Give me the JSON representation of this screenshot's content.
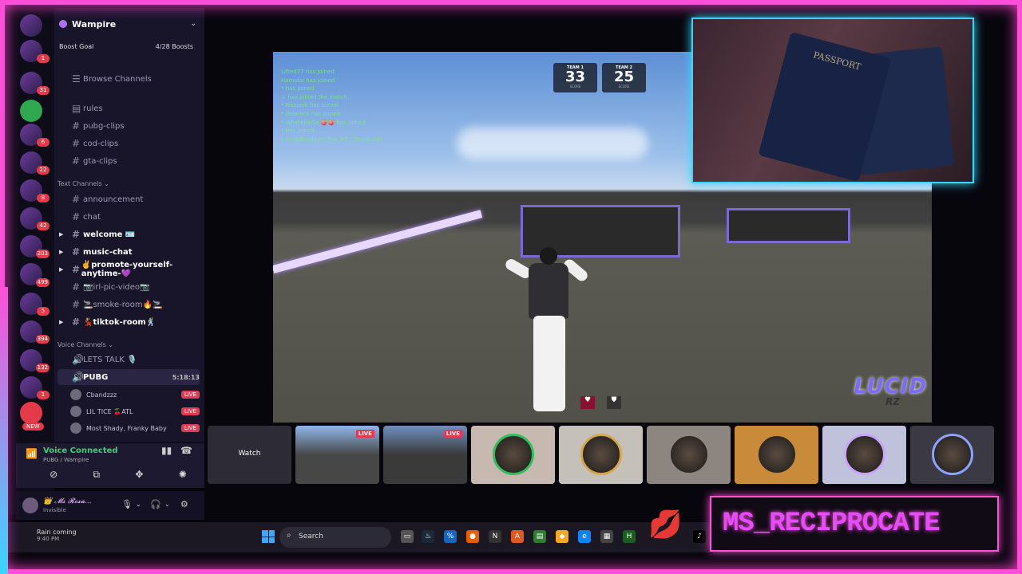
{
  "server": {
    "name": "Wampire",
    "boost_goal": "Boost Goal",
    "boosts": "4/28 Boosts"
  },
  "rail_badges": [
    "1",
    "31",
    "6",
    "22",
    "8",
    "42",
    "203",
    "499",
    "5",
    "394",
    "132",
    "1"
  ],
  "rail_new": "NEW",
  "channels_top": {
    "browse": "Browse Channels",
    "items": [
      "rules",
      "pubg-clips",
      "cod-clips",
      "gta-clips"
    ]
  },
  "text_channels": {
    "header": "Text Channels",
    "items": [
      {
        "name": "announcement",
        "bold": false
      },
      {
        "name": "chat",
        "bold": false
      },
      {
        "name": "welcome 🪪",
        "bold": true
      },
      {
        "name": "music-chat",
        "bold": true
      },
      {
        "name": "✌️promote-yourself-anytime-💜",
        "bold": true
      },
      {
        "name": "📷irl-pic-video📷",
        "bold": false
      },
      {
        "name": "🚬smoke-room🔥🚬",
        "bold": false
      },
      {
        "name": "💃tiktok-room🕺",
        "bold": true
      }
    ]
  },
  "voice_channels": {
    "header": "Voice Channels",
    "lets_talk": "LETS TALK 🎙️",
    "pubg": "PUBG",
    "pubg_time": "5:18:13",
    "users": [
      {
        "name": "Cbandzzz",
        "live": "LIVE"
      },
      {
        "name": "LIL TICE 🍒ATL",
        "live": "LIVE"
      },
      {
        "name": "Most Shady, Franky Baby",
        "live": "LIVE"
      }
    ]
  },
  "voice_panel": {
    "status": "Voice Connected",
    "location": "PUBG / Wampire"
  },
  "user_panel": {
    "name": "👑 𝓜𝓼 𝓡𝓸𝓼𝓪...",
    "status": "Invisible"
  },
  "weather": {
    "title": "Rain coming",
    "time": "9:40 PM"
  },
  "taskbar": {
    "search_placeholder": "Search"
  },
  "game": {
    "team1_label": "TEAM 1",
    "team1_score": "33",
    "team2_label": "TEAM 2",
    "team2_score": "25",
    "score_caption": "SCORE",
    "killfeed": [
      "Lifted77 has joined",
      "Hamulai has joined",
      "* has joined",
      "⚔ has joined the match",
      "* Nasserk has joined",
      "* deleroos has joined",
      "* WhereHeGo 🍑🍑 has joined",
      "* has joined",
      "* Hoochieplayer has left (Timed out)"
    ],
    "logo": "LUCID",
    "logo_sub": "RZ"
  },
  "strip": {
    "watch_label": "Watch",
    "live_label": "LIVE"
  },
  "webcam": {
    "passport_text": "PASSPORT"
  },
  "brand": {
    "text": "MS_RECIPROCATE"
  },
  "colors": {
    "frame_pink": "#ff4fd8",
    "frame_cyan": "#39d6ff",
    "live_red": "#e23b52",
    "voice_green": "#3bd279"
  }
}
